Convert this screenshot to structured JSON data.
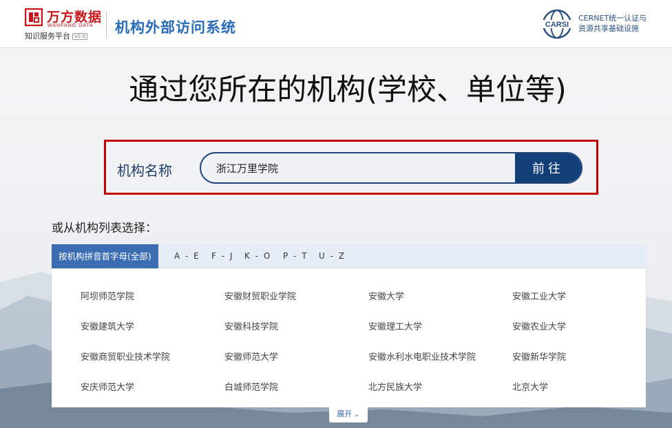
{
  "header": {
    "brand_name": "万方数据",
    "brand_name_en": "WANFANG DATA",
    "brand_subtitle": "知识服务平台",
    "brand_tag": "V2.0",
    "system_title": "机构外部访问系统",
    "carsi_logo_text": "CARSI",
    "carsi_line1": "CERNET统一认证与",
    "carsi_line2": "资源共享基础设施"
  },
  "hero": {
    "title": "通过您所在的机构(学校、单位等)"
  },
  "search": {
    "label": "机构名称",
    "value": "浙江万里学院",
    "button_label": "前往"
  },
  "list": {
    "intro": "或从机构列表选择：",
    "tabs": [
      {
        "label": "按机构拼音首字母(全部)",
        "active": true
      },
      {
        "label": "A - E",
        "active": false
      },
      {
        "label": "F - J",
        "active": false
      },
      {
        "label": "K - O",
        "active": false
      },
      {
        "label": "P - T",
        "active": false
      },
      {
        "label": "U - Z",
        "active": false
      }
    ],
    "institutions": [
      "阿坝师范学院",
      "安徽财贸职业学院",
      "安徽大学",
      "安徽工业大学",
      "安徽建筑大学",
      "安徽科技学院",
      "安徽理工大学",
      "安徽农业大学",
      "安徽商贸职业技术学院",
      "安徽师范大学",
      "安徽水利水电职业技术学院",
      "安徽新华学院",
      "安庆师范大学",
      "白城师范学院",
      "北方民族大学",
      "北京大学"
    ],
    "expand_label": "展开"
  },
  "colors": {
    "brand_red": "#c8161d",
    "title_blue": "#2b6cb8",
    "button_navy": "#123f78",
    "highlight_red": "#c00000",
    "tab_active": "#3b6db3"
  }
}
